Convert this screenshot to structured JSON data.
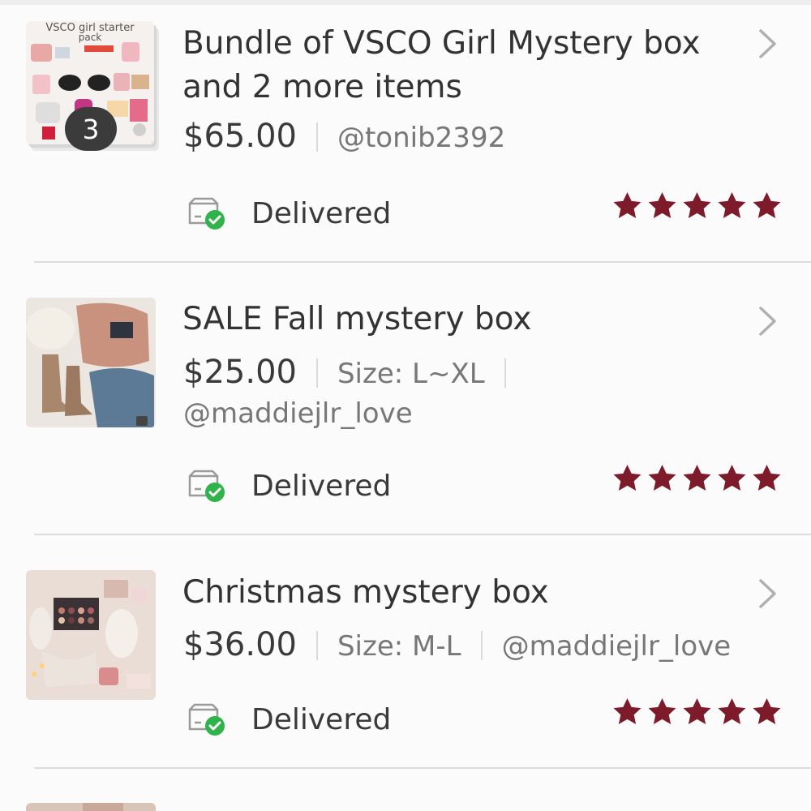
{
  "colors": {
    "background": "#fcfbfb",
    "divider": "#dcdcdc",
    "star": "#7e1b2b",
    "delivered_check": "#2fb34a",
    "text_primary": "#333333",
    "text_secondary": "#777777"
  },
  "orders": [
    {
      "title": "Bundle of VSCO Girl Mystery box and 2 more items",
      "price": "$65.00",
      "details": [
        "@tonib2392"
      ],
      "details_line2": "",
      "thumb_badge": "3",
      "thumb_caption_line1": "VSCO girl starter",
      "thumb_caption_line2": "pack",
      "status_icon": "package-delivered-icon",
      "status": "Delivered",
      "rating": 5
    },
    {
      "title": "SALE Fall mystery box",
      "price": "$25.00",
      "details": [
        "Size: L~XL"
      ],
      "details_line2": "@maddiejlr_love",
      "status_icon": "package-delivered-icon",
      "status": "Delivered",
      "rating": 5
    },
    {
      "title": "Christmas mystery box",
      "price": "$36.00",
      "details": [
        "Size: M-L",
        "@maddiejlr_love"
      ],
      "details_line2": "",
      "status_icon": "package-delivered-icon",
      "status": "Delivered",
      "rating": 5
    }
  ]
}
